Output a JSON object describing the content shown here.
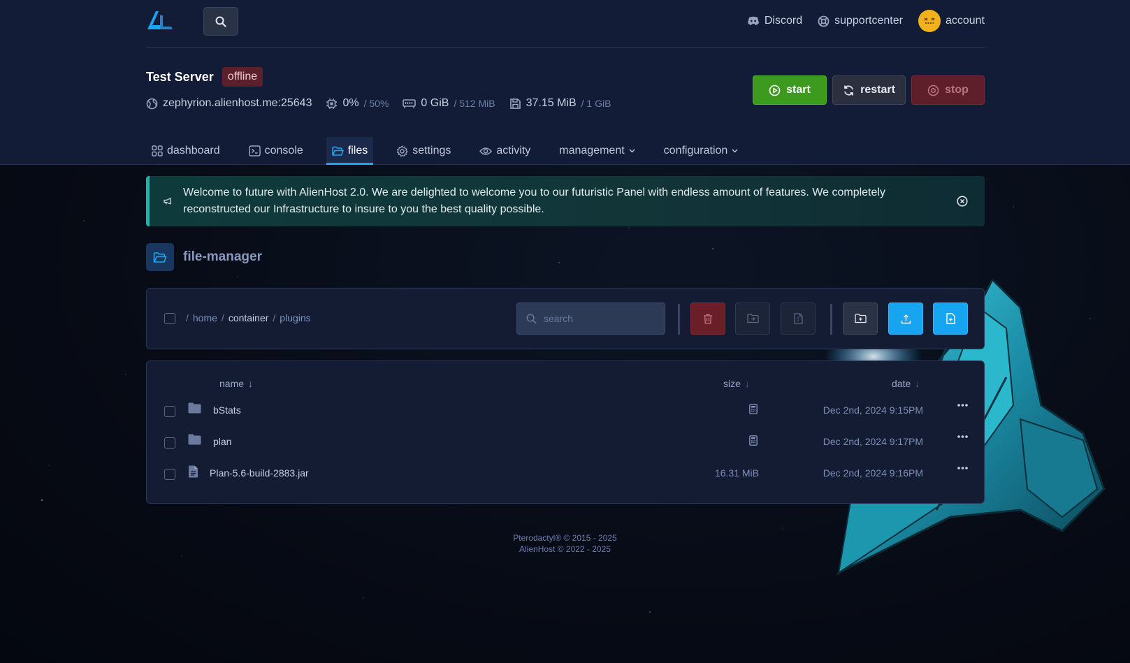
{
  "topbar": {
    "links": [
      {
        "icon": "discord-icon",
        "label": "Discord"
      },
      {
        "icon": "lifebuoy-icon",
        "label": "supportcenter"
      },
      {
        "icon": "avatar-icon",
        "label": "account"
      }
    ]
  },
  "server": {
    "name": "Test Server",
    "status": "offline",
    "address": "zephyrion.alienhost.me:25643",
    "cpu": "0%",
    "cpu_limit": "/ 50%",
    "memory": "0 GiB",
    "memory_limit": "/ 512 MiB",
    "disk": "37.15 MiB",
    "disk_limit": "/ 1 GiB"
  },
  "power": {
    "start_label": "start",
    "restart_label": "restart",
    "stop_label": "stop"
  },
  "tabs": [
    {
      "label": "dashboard",
      "active": false
    },
    {
      "label": "console",
      "active": false
    },
    {
      "label": "files",
      "active": true
    },
    {
      "label": "settings",
      "active": false
    },
    {
      "label": "activity",
      "active": false
    },
    {
      "label": "management",
      "active": false
    },
    {
      "label": "configuration",
      "active": false
    }
  ],
  "announcement": {
    "text": "Welcome to future with AlienHost 2.0. We are delighted to welcome you to our futuristic Panel with endless amount of features. We completely reconstructed our Infrastructure to insure to you the best quality possible."
  },
  "file_manager": {
    "title": "file-manager",
    "breadcrumb": [
      {
        "sep": "/",
        "label": "home"
      },
      {
        "sep": "/",
        "label": "container"
      },
      {
        "sep": "/",
        "label": "plugins"
      }
    ],
    "search_placeholder": "search",
    "columns": {
      "name": "name",
      "size": "size",
      "date": "date",
      "sort_arrow": "↓"
    },
    "rows": [
      {
        "type": "folder",
        "name": "bStats",
        "size": "",
        "date": "Dec 2nd, 2024 9:15PM"
      },
      {
        "type": "folder",
        "name": "plan",
        "size": "",
        "date": "Dec 2nd, 2024 9:17PM"
      },
      {
        "type": "file",
        "name": "Plan-5.6-build-2883.jar",
        "size": "16.31 MiB",
        "date": "Dec 2nd, 2024 9:16PM"
      }
    ]
  },
  "footer": {
    "line1": "Pterodactyl® © 2015 - 2025",
    "line2": "AlienHost © 2022 - 2025"
  },
  "colors": {
    "accent": "#1aa6f1",
    "start": "#3c9b1e",
    "stop": "#5e1f2a",
    "announcement_border": "#1cb5ab"
  }
}
